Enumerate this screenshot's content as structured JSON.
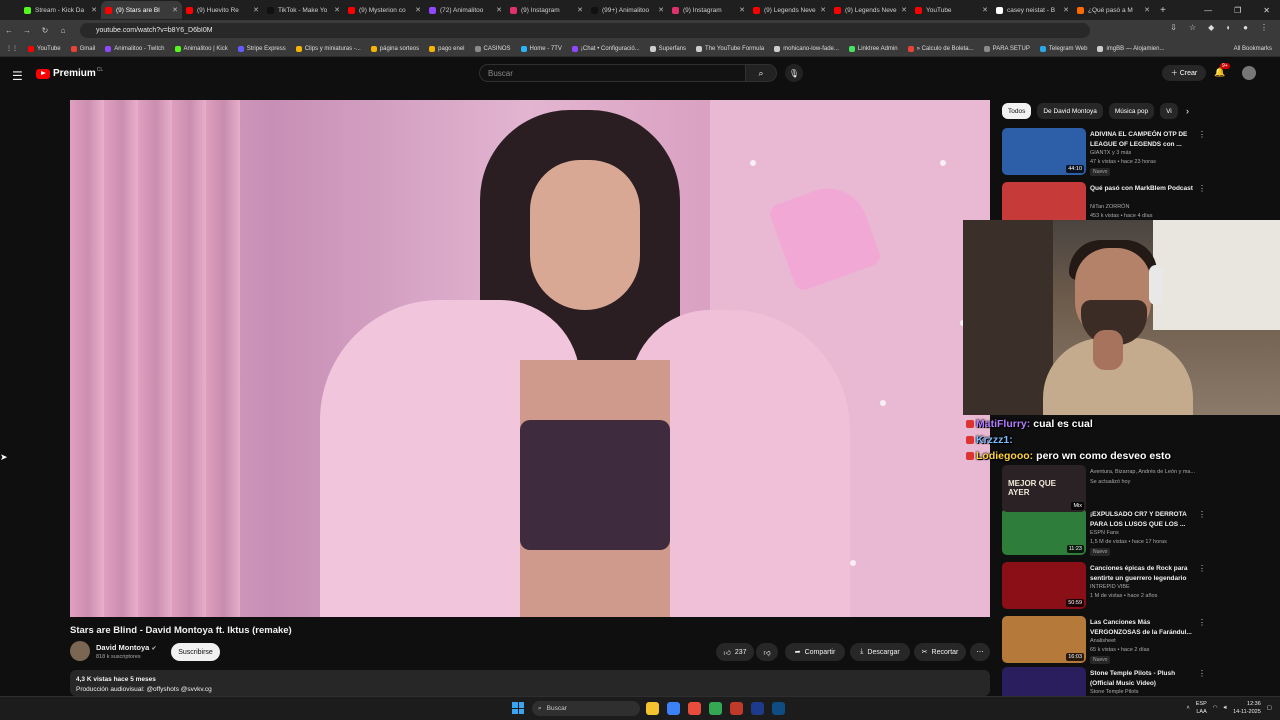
{
  "browser": {
    "tabs": [
      {
        "label": "Stream - Kick Da",
        "color": "#53fc18",
        "active": false
      },
      {
        "label": "(9) Stars are Bl",
        "color": "#ff0000",
        "active": true
      },
      {
        "label": "(9) Huevito Re",
        "color": "#ff0000",
        "active": false
      },
      {
        "label": "TikTok - Make Yo",
        "color": "#111111",
        "active": false
      },
      {
        "label": "(9) Mysterion co",
        "color": "#ff0000",
        "active": false
      },
      {
        "label": "(72) Animalitoo",
        "color": "#9146ff",
        "active": false
      },
      {
        "label": "(9) Instagram",
        "color": "#e1306c",
        "active": false
      },
      {
        "label": "(99+) Animalitoo",
        "color": "#111111",
        "active": false
      },
      {
        "label": "(9) Instagram",
        "color": "#e1306c",
        "active": false
      },
      {
        "label": "(9) Legends Neve",
        "color": "#ff0000",
        "active": false
      },
      {
        "label": "(9) Legends Neve",
        "color": "#ff0000",
        "active": false
      },
      {
        "label": "YouTube",
        "color": "#ff0000",
        "active": false
      },
      {
        "label": "casey neistat - B",
        "color": "#ffffff",
        "active": false
      },
      {
        "label": "¿Qué pasó a M",
        "color": "#ff6a00",
        "active": false
      }
    ],
    "url": "youtube.com/watch?v=b8Y6_D6bI0M",
    "bookmarks": [
      {
        "label": "YouTube",
        "color": "#ff0000"
      },
      {
        "label": "Gmail",
        "color": "#ea4335"
      },
      {
        "label": "Animalitoo - Twitch",
        "color": "#9146ff"
      },
      {
        "label": "Animalitoo | Kick",
        "color": "#53fc18"
      },
      {
        "label": "Stripe Express",
        "color": "#635bff"
      },
      {
        "label": "Clips y miniaturas -...",
        "color": "#f4b400"
      },
      {
        "label": "página sorteos",
        "color": "#f4b400"
      },
      {
        "label": "pago enel",
        "color": "#f4b400"
      },
      {
        "label": "CASINOS",
        "color": "#8a8a8a"
      },
      {
        "label": "Home - 7TV",
        "color": "#29b6f6"
      },
      {
        "label": "¡Chat • Configuració...",
        "color": "#9146ff"
      },
      {
        "label": "Superfans",
        "color": "#cccccc"
      },
      {
        "label": "The YouTube Formula",
        "color": "#cccccc"
      },
      {
        "label": "mohicano-low-fade...",
        "color": "#cccccc"
      },
      {
        "label": "Linktree Admin",
        "color": "#43e660"
      },
      {
        "label": "» Calculo de Boleta...",
        "color": "#ea4335"
      },
      {
        "label": "PARA SETUP",
        "color": "#8a8a8a"
      },
      {
        "label": "Telegram Web",
        "color": "#29a9eb"
      },
      {
        "label": "imgBB — Alojamien...",
        "color": "#cccccc"
      }
    ],
    "all_bookmarks": "All Bookmarks"
  },
  "youtube": {
    "brand": "Premium",
    "country": "CL",
    "search_placeholder": "Buscar",
    "create_label": "Crear",
    "notif_badge": "9+"
  },
  "video": {
    "title": "Stars are Blind - David Montoya ft. Iktus (remake)",
    "channel": "David Montoya",
    "subscribers": "818 k suscriptores",
    "subscribe_label": "Suscribirse",
    "likes": "237",
    "share_label": "Compartir",
    "download_label": "Descargar",
    "clip_label": "Recortar",
    "views_line": "4,3 K vistas  hace 5 meses",
    "credit_line": "Producción audiovisual: @offyshots @svvkv.cg"
  },
  "chips": [
    "Todos",
    "De David Montoya",
    "Música pop",
    "Vi"
  ],
  "recommendations": [
    {
      "title": "ADIVINA EL CAMPEÓN OTP DE LEAGUE OF LEGENDS con ...",
      "channel": "GIANTX y 3 más",
      "meta": "47 k vistas • hace 23 horas",
      "badge": "Nuevo",
      "duration": "44:10",
      "thumb": "#2d5fa8"
    },
    {
      "title": "Qué pasó con MarkBlem Podcast",
      "channel": "NiTan ZORRÓN",
      "meta": "453 k vistas • hace 4 días",
      "badge": "",
      "duration": "",
      "thumb": "#c63a3a"
    },
    {
      "title": "¡EXPULSADO CR7 Y DERROTA PARA LOS LUSOS QUE LOS ...",
      "channel": "ESPN Fans",
      "meta": "1,5 M de vistas • hace 17 horas",
      "badge": "Nuevo",
      "duration": "11:23",
      "thumb": "#2f7d3b"
    },
    {
      "title": "Canciones épicas de Rock para sentirte un guerrero legendario",
      "channel": "INTREPID VIBE",
      "meta": "1 M de vistas • hace 2 años",
      "badge": "",
      "duration": "50:59",
      "thumb": "#8a0f16"
    },
    {
      "title": "Las Canciones Más VERGONZOSAS de la Farándul...",
      "channel": "Analisheet",
      "meta": "65 k vistas • hace 2 días",
      "badge": "Nuevo",
      "duration": "16:03",
      "thumb": "#b57a3a"
    },
    {
      "title": "Stone Temple Pilots - Plush (Official Music Video)",
      "channel": "Stone Temple Pilots",
      "meta": "",
      "badge": "",
      "duration": "",
      "thumb": "#2a1e5e"
    }
  ],
  "partial_rec": {
    "meta": "Aventura, Bizarrap, Andrés de León y ma...",
    "updated": "Se actualizó hoy",
    "thumb_text": "MEJOR QUE AYER",
    "mix": "Mix"
  },
  "chat": [
    {
      "user": "MatiFlurry:",
      "message": "cual es cual",
      "color": "#b57cff"
    },
    {
      "user": "Krzzz1:",
      "message": "",
      "color": "#7bbcff"
    },
    {
      "user": "Lodiegooo:",
      "message": "pero wn como desveo esto",
      "color": "#ffd23f"
    }
  ],
  "taskbar": {
    "search_label": "Buscar",
    "lang_top": "ESP",
    "lang_bottom": "LAA",
    "time": "12:36",
    "date": "14-11-2025",
    "app_colors": [
      "#f4c430",
      "#3b82f6",
      "#e74c3c",
      "#34a853",
      "#c0392b",
      "#1e3a8a",
      "#0f4c81"
    ]
  }
}
